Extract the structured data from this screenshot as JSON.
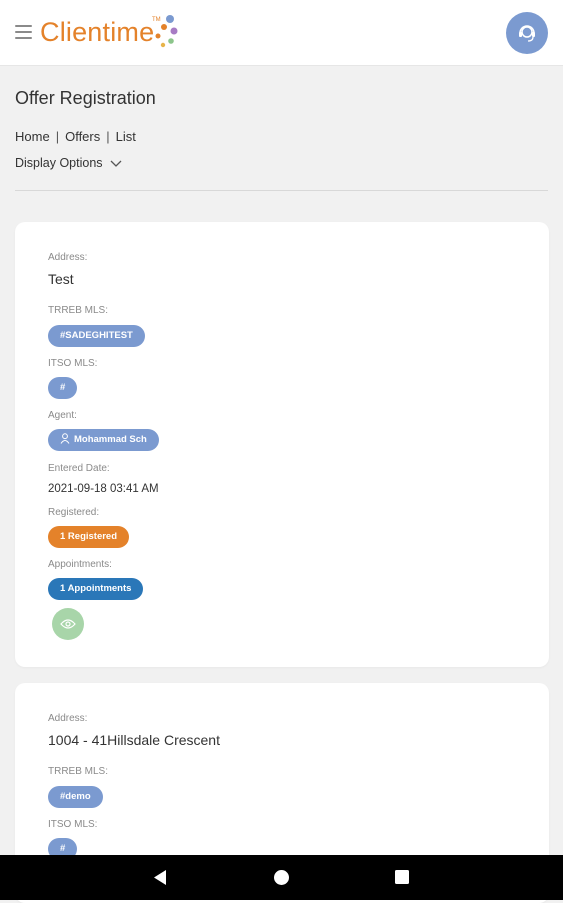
{
  "colors": {
    "brand_orange": "#e4822a",
    "badge_blue": "#7b9ad0",
    "badge_orange": "#e4822a",
    "badge_dark_blue": "#2a77b8",
    "view_green": "#a8d5a9"
  },
  "header": {
    "logo_text": "Clientime",
    "logo_tm": "TM",
    "menu_icon": "hamburger-icon",
    "avatar_icon": "support-agent-icon"
  },
  "page": {
    "title": "Offer Registration",
    "breadcrumb": [
      "Home",
      "Offers",
      "List"
    ],
    "breadcrumb_sep": "|",
    "display_options_label": "Display Options"
  },
  "cards": [
    {
      "address_label": "Address:",
      "address": "Test",
      "trreb_label": "TRREB MLS:",
      "trreb": "#SADEGHITEST",
      "itso_label": "ITSO MLS:",
      "itso": "#",
      "agent_label": "Agent:",
      "agent": "Mohammad Sch",
      "entered_label": "Entered Date:",
      "entered": "2021-09-18 03:41 AM",
      "registered_label": "Registered:",
      "registered": "1 Registered",
      "appointments_label": "Appointments:",
      "appointments": "1 Appointments"
    },
    {
      "address_label": "Address:",
      "address": "1004 - 41Hillsdale Crescent",
      "trreb_label": "TRREB MLS:",
      "trreb": "#demo",
      "itso_label": "ITSO MLS:",
      "itso": "#"
    }
  ],
  "navbar": {
    "back_icon": "back-triangle-icon",
    "home_icon": "home-circle-icon",
    "recents_icon": "recents-square-icon"
  }
}
